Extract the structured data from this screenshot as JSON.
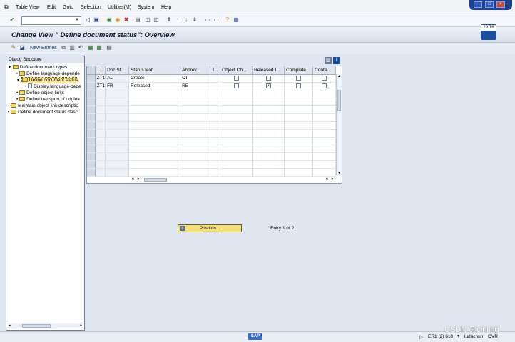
{
  "menu": {
    "items": [
      "Table View",
      "Edit",
      "Goto",
      "Selection",
      "Utilities(M)",
      "System",
      "Help"
    ]
  },
  "window": {
    "minimize_icon": "minimize-icon",
    "restore_icon": "restore-icon",
    "close_icon": "close-icon"
  },
  "title": {
    "text": "Change View \" Define document status\": Overview",
    "badge": "29 T6"
  },
  "app_toolbar": {
    "new_entries": "New Entries"
  },
  "dialog_structure": {
    "header": "Dialog Structure",
    "items": [
      {
        "label": "Define document types",
        "level": 0,
        "type": "folder",
        "expanded": true,
        "selected": false
      },
      {
        "label": "Define language-depende",
        "level": 1,
        "type": "folder",
        "selected": false
      },
      {
        "label": "Define document status",
        "level": 1,
        "type": "folder",
        "expanded": true,
        "selected": true
      },
      {
        "label": "Display language-depe",
        "level": 2,
        "type": "doc",
        "selected": false
      },
      {
        "label": "Define object links",
        "level": 1,
        "type": "folder",
        "selected": false
      },
      {
        "label": "Define transport of origina",
        "level": 1,
        "type": "folder",
        "selected": false
      },
      {
        "label": "Maintain object link descriptio",
        "level": 0,
        "type": "folder",
        "selected": false
      },
      {
        "label": "Define document status desc",
        "level": 0,
        "type": "folder",
        "selected": false
      }
    ]
  },
  "table": {
    "columns": [
      "T...",
      "Doc.St.",
      "Status text",
      "Abbrev.",
      "T...",
      "Object Ch...",
      "Released I...",
      "Complete",
      "Conte..."
    ],
    "rows": [
      {
        "type": "ZT1",
        "doc_st": "AL",
        "status_text": "Create",
        "abbrev": "CT",
        "t": "",
        "object_ch": false,
        "released": false,
        "complete": false,
        "content": false
      },
      {
        "type": "ZT1",
        "doc_st": "FR",
        "status_text": "Released",
        "abbrev": "RE",
        "t": "",
        "object_ch": false,
        "released": true,
        "complete": false,
        "content": false
      }
    ],
    "empty_rows": 11
  },
  "position": {
    "label": "Position...",
    "entry_info": "Entry 1 of 2"
  },
  "status_bar": {
    "logo": "SAP",
    "system": "ER1 (2) 610",
    "user": "ludachun",
    "mode": "OVR"
  },
  "watermark": "CSDN @cinling"
}
